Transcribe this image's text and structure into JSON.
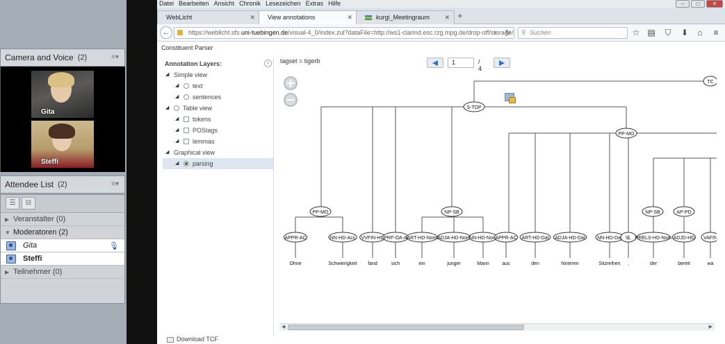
{
  "meeting": {
    "camera_pod": {
      "title": "Camera and Voice",
      "count": "(2)",
      "menu": "≡▾"
    },
    "videos": [
      {
        "name": "Gita"
      },
      {
        "name": "Steffi"
      }
    ],
    "attendee_pod": {
      "title": "Attendee List",
      "count": "(2)",
      "menu": "≡▾"
    },
    "groups": [
      {
        "label": "Veranstalter (0)"
      },
      {
        "label": "Moderatoren (2)"
      },
      {
        "label": "Teilnehmer (0)"
      }
    ],
    "moderators": [
      {
        "name": "Gita"
      },
      {
        "name": "Steffi"
      }
    ]
  },
  "browser": {
    "menu": [
      "Datei",
      "Bearbeiten",
      "Ansicht",
      "Chronik",
      "Lesezeichen",
      "Extras",
      "Hilfe"
    ],
    "tabs": [
      {
        "label": "WebLicht"
      },
      {
        "label": "View annotations"
      },
      {
        "label": "kurgi_Meetingraum"
      }
    ],
    "new_tab": "+",
    "url_prefix": "https://weblicht.sfs.",
    "url_domain": "uni-tuebingen.de",
    "url_rest": "/visual-4_0/index.zul?dataFile=http://ws1-clarind.esc.rzg.mpg.de/drop-off/storage/res",
    "search_placeholder": "Suchen"
  },
  "page": {
    "title": "Constituent Parser",
    "layers_title": "Annotation Layers:",
    "tree": [
      {
        "label": "Simple view",
        "type": "group",
        "level": 0
      },
      {
        "label": "text",
        "type": "radio",
        "level": 1,
        "on": false
      },
      {
        "label": "sentences",
        "type": "radio",
        "level": 1,
        "on": false
      },
      {
        "label": "Table view",
        "type": "group-radio",
        "level": 0,
        "on": false
      },
      {
        "label": "tokens",
        "type": "check",
        "level": 1
      },
      {
        "label": "POStags",
        "type": "check",
        "level": 1
      },
      {
        "label": "lemmas",
        "type": "check",
        "level": 1
      },
      {
        "label": "Graphical view",
        "type": "group",
        "level": 0
      },
      {
        "label": "parsing",
        "type": "radio",
        "level": 1,
        "on": true,
        "selected": true
      }
    ],
    "tagset": "tagset = tigerb",
    "pager": {
      "current": "1",
      "total": "/ 4"
    },
    "download": "Download TCF"
  },
  "parse_tree": {
    "top_nodes": [
      "TC",
      "S-TOP",
      "PP-MO"
    ],
    "phrase_nodes": [
      "PP-MO",
      "NP-SB",
      "NP-SB",
      "AP-PD"
    ],
    "pos_nodes": [
      "APPR-AC",
      "NN-HD-Acc",
      "VVFIN-HD",
      "PRF-OA-A",
      "ART-HD-Nom",
      "ADJA-HD-Nom",
      "NN-HD-Nom",
      "APPR-AC",
      "ART-HD-Dat",
      "ADJA-HD-Dat",
      "NN-HD-Dat",
      "\\$,",
      "PRELS-HD-Nom",
      "ADJD-HD",
      "VAFIN"
    ],
    "words": [
      "Ohne",
      "Schwierigkeit",
      "fand",
      "sich",
      "ein",
      "junger",
      "Mann",
      "aus",
      "den",
      "hinteren",
      "Sitzreihen",
      ",",
      "der",
      "bereit",
      "wa"
    ]
  }
}
